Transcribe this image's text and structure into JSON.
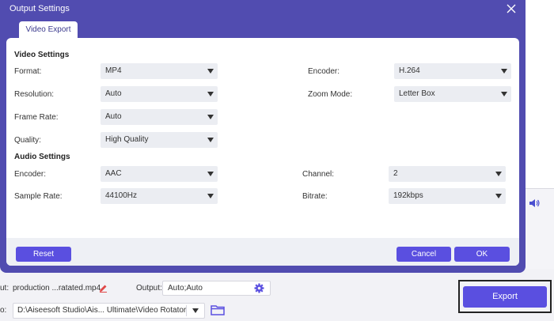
{
  "dialog": {
    "title": "Output Settings",
    "tab_label": "Video Export"
  },
  "video_settings": {
    "section_title": "Video Settings",
    "format": {
      "label": "Format:",
      "value": "MP4"
    },
    "encoder": {
      "label": "Encoder:",
      "value": "H.264"
    },
    "resolution": {
      "label": "Resolution:",
      "value": "Auto"
    },
    "zoom_mode": {
      "label": "Zoom Mode:",
      "value": "Letter Box"
    },
    "frame_rate": {
      "label": "Frame Rate:",
      "value": "Auto"
    },
    "quality": {
      "label": "Quality:",
      "value": "High Quality"
    }
  },
  "audio_settings": {
    "section_title": "Audio Settings",
    "encoder": {
      "label": "Encoder:",
      "value": "AAC"
    },
    "channel": {
      "label": "Channel:",
      "value": "2"
    },
    "sample_rate": {
      "label": "Sample Rate:",
      "value": "44100Hz"
    },
    "bitrate": {
      "label": "Bitrate:",
      "value": "192kbps"
    }
  },
  "buttons": {
    "reset": "Reset",
    "cancel": "Cancel",
    "ok": "OK"
  },
  "app": {
    "file_label_fragment": "ut:",
    "file_name": "production ...ratated.mp4",
    "output_label": "Output:",
    "output_value": "Auto;Auto",
    "save_label_fragment": "o:",
    "save_path": "D:\\Aiseesoft Studio\\Ais... Ultimate\\Video Rotator",
    "export_label": "Export"
  },
  "colors": {
    "dialog_header": "#514cb0",
    "accent": "#5a4fe0",
    "select_bg": "#ebedf2"
  }
}
